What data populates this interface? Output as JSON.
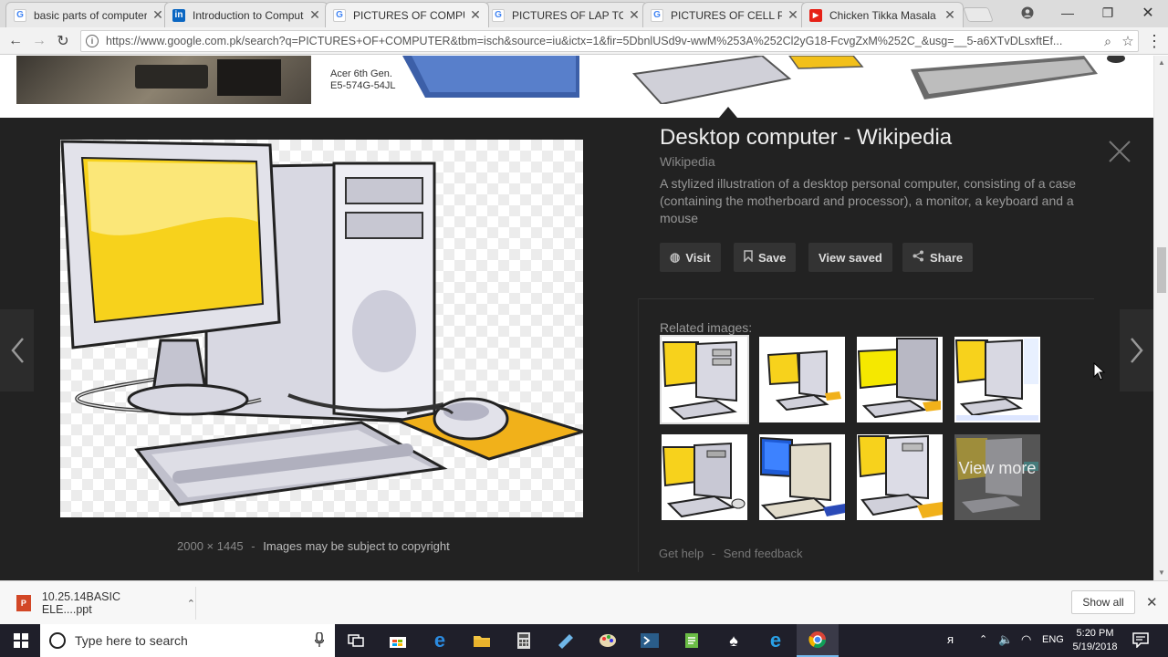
{
  "tabs": [
    {
      "title": "basic parts of computer",
      "favicon": "google-icon",
      "favicon_color": "#4285f4"
    },
    {
      "title": "Introduction to Comput",
      "favicon": "linkedin-icon",
      "favicon_color": "#0a66c2"
    },
    {
      "title": "PICTURES OF COMPUTE",
      "favicon": "google-icon",
      "favicon_color": "#4285f4",
      "active": true
    },
    {
      "title": "PICTURES OF LAP TOP -",
      "favicon": "google-icon",
      "favicon_color": "#4285f4"
    },
    {
      "title": "PICTURES OF CELL PHO",
      "favicon": "google-icon",
      "favicon_color": "#4285f4"
    },
    {
      "title": "Chicken Tikka Masala -",
      "favicon": "youtube-icon",
      "favicon_color": "#e62117"
    }
  ],
  "address_bar": {
    "url": "https://www.google.com.pk/search?q=PICTURES+OF+COMPUTER&tbm=isch&source=iu&ictx=1&fir=5DbnlUSd9v-wwM%253A%252Cl2yG18-FcvgZxM%252C_&usg=__5-a6XTvDLsxftEf..."
  },
  "results_strip": {
    "laptop_caption_1": "Acer 6th Gen.",
    "laptop_caption_2": "E5-574G-54JL"
  },
  "preview": {
    "title": "Desktop computer - Wikipedia",
    "source": "Wikipedia",
    "description": "A stylized illustration of a desktop personal computer, consisting of a case (containing the motherboard and processor), a monitor, a keyboard and a mouse",
    "dimensions": "2000 × 1445",
    "separator": "-",
    "copyright_note": "Images may be subject to copyright",
    "buttons": {
      "visit": "Visit",
      "save": "Save",
      "view_saved": "View saved",
      "share": "Share"
    },
    "related_label": "Related images:",
    "view_more": "View more",
    "get_help": "Get help",
    "send_feedback": "Send feedback",
    "help_separator": "-"
  },
  "download_shelf": {
    "file_name": "10.25.14BASIC ELE....ppt",
    "show_all": "Show all"
  },
  "taskbar": {
    "search_placeholder": "Type here to search",
    "language": "ENG",
    "time": "5:20 PM",
    "date": "5/19/2018"
  }
}
